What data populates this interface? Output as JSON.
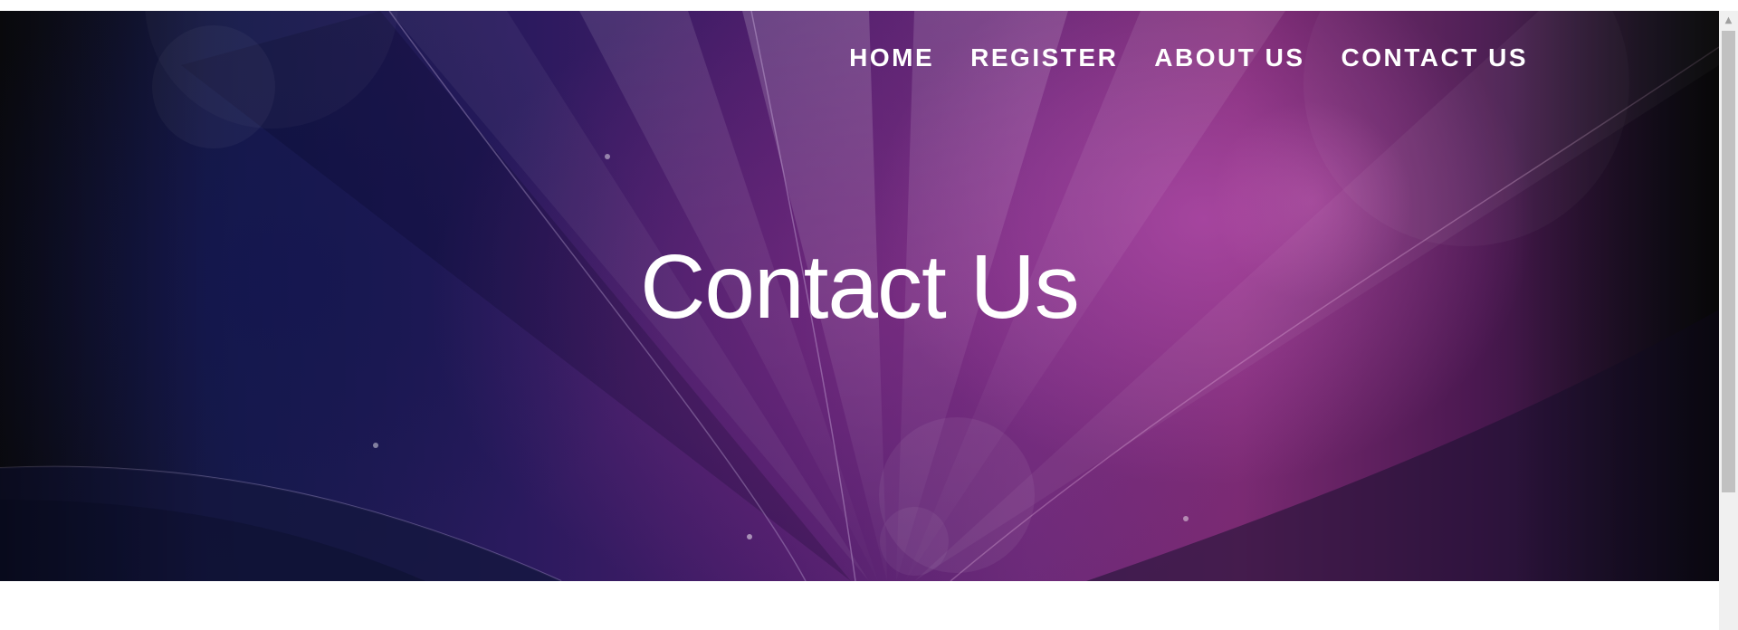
{
  "nav": {
    "items": [
      {
        "label": "HOME"
      },
      {
        "label": "REGISTER"
      },
      {
        "label": "ABOUT US"
      },
      {
        "label": "CONTACT US"
      }
    ]
  },
  "hero": {
    "title": "Contact Us"
  },
  "scrollbar": {
    "up_arrow": "▲"
  },
  "colors": {
    "hero_dark": "#101016",
    "hero_navy": "#161a4a",
    "hero_purple": "#4a1d6a",
    "hero_magenta": "#7a2a72",
    "text": "#ffffff"
  }
}
